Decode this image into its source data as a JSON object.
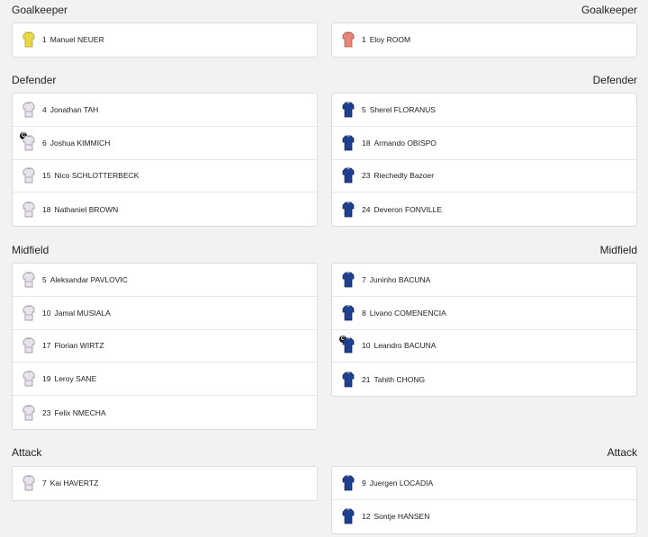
{
  "sections": {
    "goalkeeper": {
      "left_title": "Goalkeeper",
      "right_title": "Goalkeeper"
    },
    "defender": {
      "left_title": "Defender",
      "right_title": "Defender"
    },
    "midfield": {
      "left_title": "Midfield",
      "right_title": "Midfield"
    },
    "attack": {
      "left_title": "Attack",
      "right_title": "Attack"
    }
  },
  "captain_badge": "C",
  "colors": {
    "home_gk": "#e8d84a",
    "away_gk": "#e8857a",
    "home_kit": "#e8e4ec",
    "away_kit": "#1f3f8f"
  },
  "home": {
    "goalkeeper": [
      {
        "number": "1",
        "name": "Manuel NEUER"
      }
    ],
    "defender": [
      {
        "number": "4",
        "name": "Jonathan TAH"
      },
      {
        "number": "6",
        "name": "Joshua KIMMICH"
      },
      {
        "number": "15",
        "name": "Nico SCHLOTTERBECK"
      },
      {
        "number": "18",
        "name": "Nathaniel BROWN"
      }
    ],
    "midfield": [
      {
        "number": "5",
        "name": "Aleksandar PAVLOVIC"
      },
      {
        "number": "10",
        "name": "Jamal MUSIALA"
      },
      {
        "number": "17",
        "name": "Florian WIRTZ"
      },
      {
        "number": "19",
        "name": "Leroy SANE"
      },
      {
        "number": "23",
        "name": "Felix NMECHA"
      }
    ],
    "attack": [
      {
        "number": "7",
        "name": "Kai HAVERTZ"
      }
    ]
  },
  "away": {
    "goalkeeper": [
      {
        "number": "1",
        "name": "Eloy ROOM"
      }
    ],
    "defender": [
      {
        "number": "5",
        "name": "Sherel FLORANUS"
      },
      {
        "number": "18",
        "name": "Armando OBISPO"
      },
      {
        "number": "23",
        "name": "Riechedly Bazoer"
      },
      {
        "number": "24",
        "name": "Deveron FONVILLE"
      }
    ],
    "midfield": [
      {
        "number": "7",
        "name": "Juninho BACUNA"
      },
      {
        "number": "8",
        "name": "Livano COMENENCIA"
      },
      {
        "number": "10",
        "name": "Leandro BACUNA"
      },
      {
        "number": "21",
        "name": "Tahith CHONG"
      }
    ],
    "attack": [
      {
        "number": "9",
        "name": "Juergen LOCADIA"
      },
      {
        "number": "12",
        "name": "Sontje HANSEN"
      }
    ]
  }
}
